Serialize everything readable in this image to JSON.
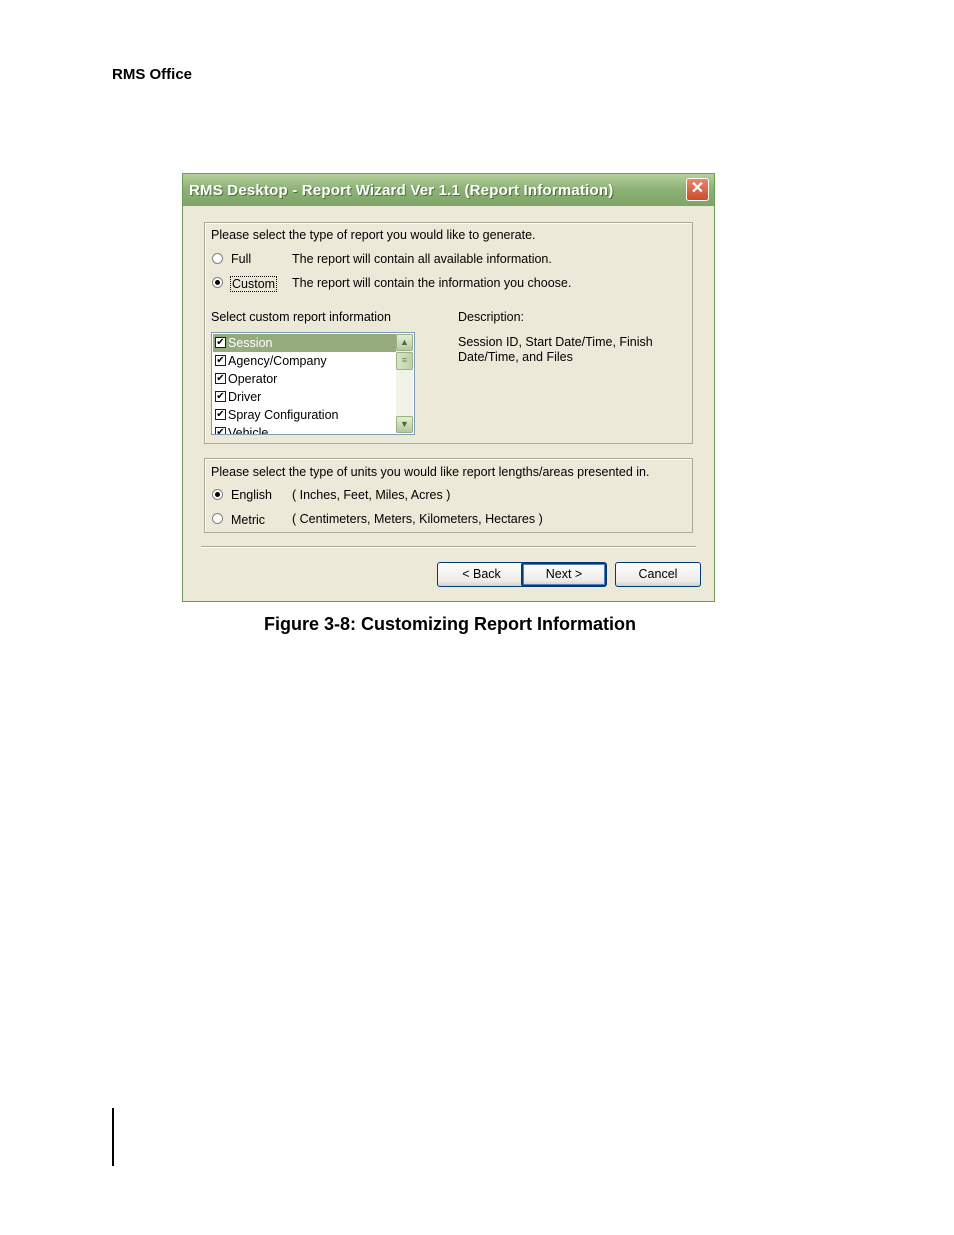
{
  "running_head": "RMS Office",
  "caption": "Figure 3-8: Customizing Report Information",
  "dialog": {
    "title": "RMS Desktop - Report Wizard Ver 1.1  (Report Information)",
    "close_glyph": "✕",
    "report_type": {
      "prompt": "Please select the type of report you would like to generate.",
      "options": [
        {
          "label": "Full",
          "description": "The report will contain all available information.",
          "selected": false
        },
        {
          "label": "Custom",
          "description": "The report will contain the information you choose.",
          "selected": true
        }
      ]
    },
    "custom_info": {
      "label": "Select custom report information",
      "items": [
        {
          "label": "Session",
          "checked": true,
          "selected": true
        },
        {
          "label": "Agency/Company",
          "checked": true,
          "selected": false
        },
        {
          "label": "Operator",
          "checked": true,
          "selected": false
        },
        {
          "label": "Driver",
          "checked": true,
          "selected": false
        },
        {
          "label": "Spray Configuration",
          "checked": true,
          "selected": false
        },
        {
          "label": "Vehicle",
          "checked": true,
          "selected": false
        }
      ]
    },
    "description": {
      "label": "Description:",
      "text_line1": "Session ID, Start Date/Time, Finish",
      "text_line2": "Date/Time, and Files"
    },
    "units": {
      "prompt": "Please select the type of units you would like report lengths/areas presented in.",
      "options": [
        {
          "label": "English",
          "description": "( Inches, Feet, Miles, Acres )",
          "selected": true
        },
        {
          "label": "Metric",
          "description": "( Centimeters, Meters, Kilometers, Hectares )",
          "selected": false
        }
      ]
    },
    "buttons": {
      "back": "< Back",
      "next": "Next >",
      "cancel": "Cancel"
    }
  }
}
